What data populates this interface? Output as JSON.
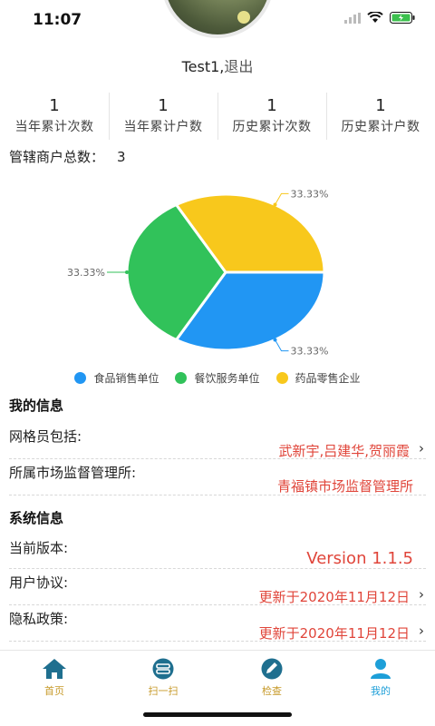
{
  "status": {
    "time": "11:07"
  },
  "user": {
    "name": "Test1",
    "sep": ",",
    "logout": "退出"
  },
  "stats": [
    {
      "value": "1",
      "label": "当年累计次数"
    },
    {
      "value": "1",
      "label": "当年累计户数"
    },
    {
      "value": "1",
      "label": "历史累计次数"
    },
    {
      "value": "1",
      "label": "历史累计户数"
    }
  ],
  "total": {
    "label": "管辖商户总数：",
    "value": "3"
  },
  "chart_data": {
    "type": "pie",
    "categories": [
      "食品销售单位",
      "餐饮服务单位",
      "药品零售企业"
    ],
    "values": [
      33.33,
      33.33,
      33.33
    ],
    "labels": [
      "33.33%",
      "33.33%",
      "33.33%"
    ],
    "colors": [
      "#2196f3",
      "#31c25a",
      "#f8c81c"
    ],
    "legend": "bottom"
  },
  "my_info": {
    "title": "我的信息",
    "grid_label": "网格员包括:",
    "grid_value": "武新宇,吕建华,贺丽霞",
    "office_label": "所属市场监督管理所:",
    "office_value": "青福镇市场监督管理所"
  },
  "sys_info": {
    "title": "系统信息",
    "version_label": "当前版本:",
    "version_value": "Version 1.1.5",
    "agreement_label": "用户协议:",
    "agreement_value": "更新于2020年11月12日",
    "privacy_label": "隐私政策:",
    "privacy_value": "更新于2020年11月12日"
  },
  "tabs": [
    {
      "label": "首页",
      "icon": "home-icon"
    },
    {
      "label": "扫一扫",
      "icon": "scan-icon"
    },
    {
      "label": "检查",
      "icon": "edit-icon"
    },
    {
      "label": "我的",
      "icon": "profile-icon"
    }
  ],
  "colors": {
    "accent": "#1e9fd8",
    "tab_inactive": "#c79a2a",
    "value_red": "#e0453a"
  }
}
